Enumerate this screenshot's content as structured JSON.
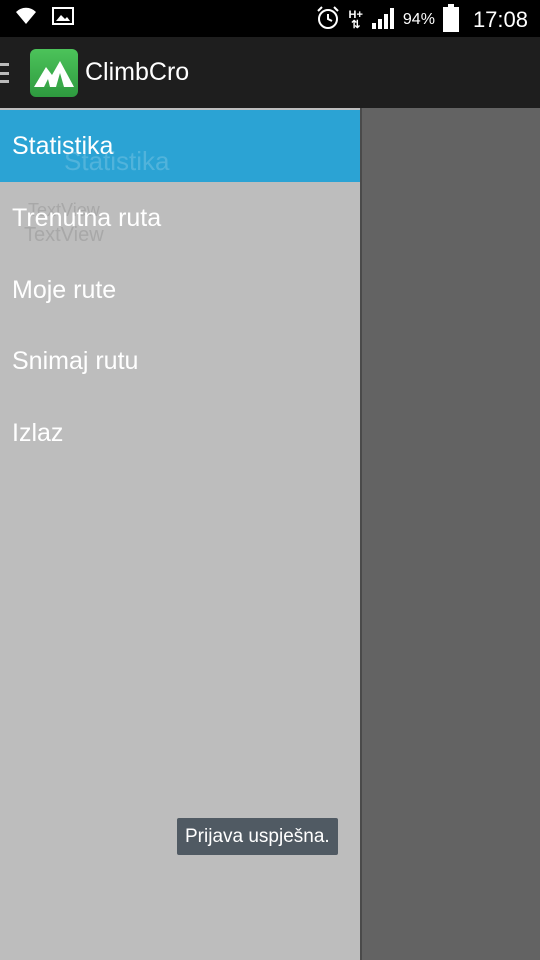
{
  "status_bar": {
    "battery_text": "94%",
    "time": "17:08",
    "network_text": "H+",
    "icons": [
      "wifi-icon",
      "image-icon",
      "alarm-icon",
      "network-icon",
      "signal-icon",
      "battery-icon"
    ]
  },
  "action_bar": {
    "title": "ClimbCro",
    "icon": "mountain-icon",
    "drawer_indicator": "menu-icon"
  },
  "background_content": {
    "ghost_texts": [
      "TextView",
      "TextView",
      "Statistika"
    ]
  },
  "drawer": {
    "items": [
      {
        "label": "Statistika",
        "selected": true
      },
      {
        "label": "Trenutna ruta",
        "selected": false
      },
      {
        "label": "Moje rute",
        "selected": false
      },
      {
        "label": "Snimaj rutu",
        "selected": false
      },
      {
        "label": "Izlaz",
        "selected": false
      }
    ]
  },
  "toast": {
    "message": "Prijava uspješna."
  },
  "colors": {
    "selected_item": "#2ba3d4",
    "drawer_bg": "#bdbdbd",
    "scrim": "#636363",
    "action_bar": "#1e1e1e",
    "toast_bg": "#505a63"
  }
}
